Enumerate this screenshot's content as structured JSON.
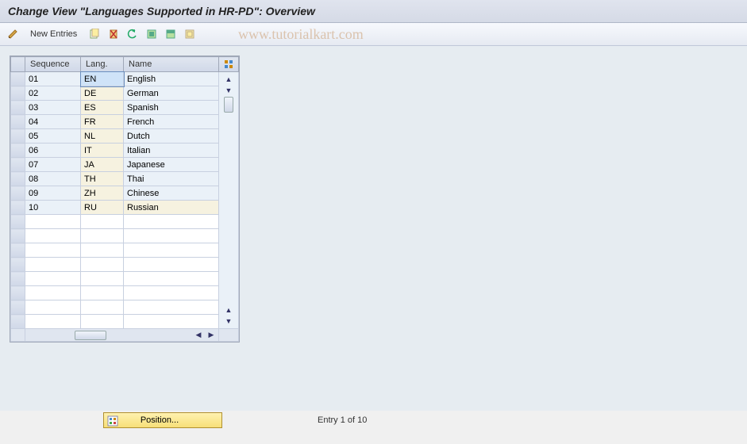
{
  "title": "Change View \"Languages Supported in HR-PD\": Overview",
  "watermark": "www.tutorialkart.com",
  "toolbar": {
    "new_entries": "New Entries"
  },
  "table": {
    "headers": {
      "sequence": "Sequence",
      "lang": "Lang.",
      "name": "Name"
    },
    "rows": [
      {
        "seq": "01",
        "lang": "EN",
        "name": "English"
      },
      {
        "seq": "02",
        "lang": "DE",
        "name": "German"
      },
      {
        "seq": "03",
        "lang": "ES",
        "name": "Spanish"
      },
      {
        "seq": "04",
        "lang": "FR",
        "name": "French"
      },
      {
        "seq": "05",
        "lang": "NL",
        "name": "Dutch"
      },
      {
        "seq": "06",
        "lang": "IT",
        "name": "Italian"
      },
      {
        "seq": "07",
        "lang": "JA",
        "name": "Japanese"
      },
      {
        "seq": "08",
        "lang": "TH",
        "name": "Thai"
      },
      {
        "seq": "09",
        "lang": "ZH",
        "name": "Chinese"
      },
      {
        "seq": "10",
        "lang": "RU",
        "name": "Russian"
      }
    ],
    "empty_rows": 8,
    "selected_cell": {
      "row": 0,
      "col": "lang"
    }
  },
  "footer": {
    "position_btn": "Position...",
    "entry_text": "Entry 1 of 10"
  }
}
